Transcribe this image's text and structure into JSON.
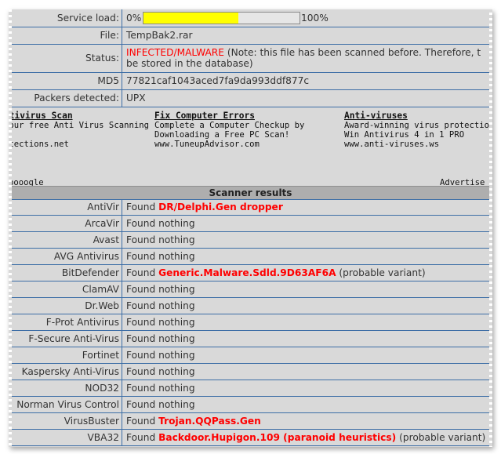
{
  "info": {
    "service_load_label": "Service load:",
    "load_left": "0%",
    "load_right": "100%",
    "load_fraction": 0.61,
    "file_label": "File:",
    "file_value": "TempBak2.rar",
    "status_label": "Status:",
    "status_value": "INFECTED/MALWARE",
    "status_note_line1": " (Note: this file has been scanned before. Therefore, t",
    "status_note_line2": "be stored in the database)",
    "md5_label": "MD5",
    "md5_value": "77821caf1043aced7fa9da993ddf877c",
    "packers_label": "Packers detected:",
    "packers_value": "UPX"
  },
  "ads": [
    {
      "title": "ntivirus Scan",
      "lines": [
        "your free Anti Virus Scanning",
        "",
        "etections.net"
      ]
    },
    {
      "title": "Fix Computer Errors",
      "lines": [
        "Complete a Computer Checkup by",
        "Downloading a Free PC Scan!",
        "www.TuneupAdvisor.com"
      ]
    },
    {
      "title": "Anti-viruses",
      "lines": [
        "Award-winning virus protection Dow",
        "Win Antivirus 4 in 1 PRO",
        "www.anti-viruses.ws"
      ]
    }
  ],
  "ads_footer": {
    "left": "oooogle",
    "right": "Advertise o"
  },
  "results_title": "Scanner results",
  "results": [
    {
      "scanner": "AntiVir",
      "found": "Found",
      "result": "DR/Delphi.Gen dropper",
      "malware": true,
      "note": ""
    },
    {
      "scanner": "ArcaVir",
      "found": "Found nothing",
      "result": "",
      "malware": false,
      "note": ""
    },
    {
      "scanner": "Avast",
      "found": "Found nothing",
      "result": "",
      "malware": false,
      "note": ""
    },
    {
      "scanner": "AVG Antivirus",
      "found": "Found nothing",
      "result": "",
      "malware": false,
      "note": ""
    },
    {
      "scanner": "BitDefender",
      "found": "Found",
      "result": "Generic.Malware.Sdld.9D63AF6A",
      "malware": true,
      "note": "(probable variant)"
    },
    {
      "scanner": "ClamAV",
      "found": "Found nothing",
      "result": "",
      "malware": false,
      "note": ""
    },
    {
      "scanner": "Dr.Web",
      "found": "Found nothing",
      "result": "",
      "malware": false,
      "note": ""
    },
    {
      "scanner": "F-Prot Antivirus",
      "found": "Found nothing",
      "result": "",
      "malware": false,
      "note": ""
    },
    {
      "scanner": "F-Secure Anti-Virus",
      "found": "Found nothing",
      "result": "",
      "malware": false,
      "note": ""
    },
    {
      "scanner": "Fortinet",
      "found": "Found nothing",
      "result": "",
      "malware": false,
      "note": ""
    },
    {
      "scanner": "Kaspersky Anti-Virus",
      "found": "Found nothing",
      "result": "",
      "malware": false,
      "note": ""
    },
    {
      "scanner": "NOD32",
      "found": "Found nothing",
      "result": "",
      "malware": false,
      "note": ""
    },
    {
      "scanner": "Norman Virus Control",
      "found": "Found nothing",
      "result": "",
      "malware": false,
      "note": ""
    },
    {
      "scanner": "VirusBuster",
      "found": "Found",
      "result": "Trojan.QQPass.Gen",
      "malware": true,
      "note": ""
    },
    {
      "scanner": "VBA32",
      "found": "Found",
      "result": "Backdoor.Hupigon.109 (paranoid heuristics)",
      "malware": true,
      "note": "(probable variant)"
    }
  ],
  "colors": {
    "infected": "#ff0000",
    "load_bar": "#ffff00",
    "row_border": "#3d6ea6"
  }
}
